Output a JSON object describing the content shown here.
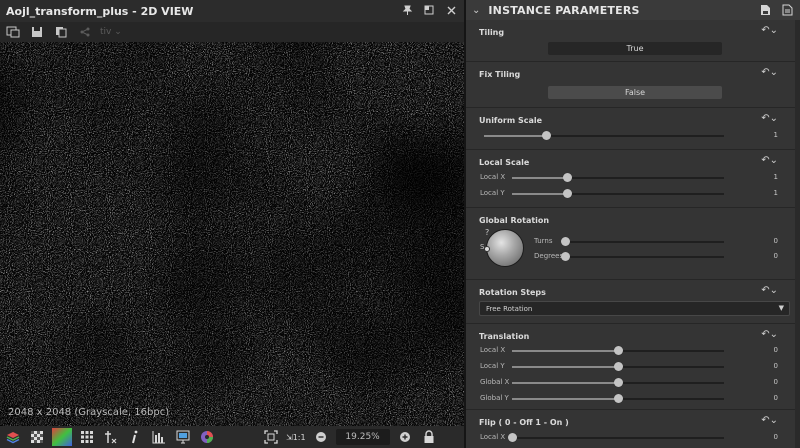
{
  "view": {
    "title": "Aojl_transform_plus - 2D VIEW",
    "toolbar_dropdown": "tiv",
    "image_info": "2048 x 2048 (Grayscale, 16bpc)",
    "zoom": "19.25%"
  },
  "params": {
    "header": "INSTANCE PARAMETERS",
    "tiling": {
      "label": "Tiling",
      "value": "True"
    },
    "fix_tiling": {
      "label": "Fix Tiling",
      "value": "False"
    },
    "uniform_scale": {
      "label": "Uniform Scale",
      "value": "1",
      "level": 0.26
    },
    "local_scale": {
      "label": "Local Scale",
      "x_label": "Local X",
      "x_value": "1",
      "x_level": 0.26,
      "y_label": "Local Y",
      "y_value": "1",
      "y_level": 0.26
    },
    "global_rotation": {
      "label": "Global Rotation",
      "dial_s": "S",
      "dial_mark": "?",
      "turns_label": "Turns",
      "turns_value": "0",
      "turns_level": 0.0,
      "degrees_label": "Degrees",
      "degrees_value": "0",
      "degrees_level": 0.0
    },
    "rotation_steps": {
      "label": "Rotation Steps",
      "value": "Free Rotation"
    },
    "translation": {
      "label": "Translation",
      "rows": [
        {
          "label": "Local X",
          "value": "0",
          "level": 0.5
        },
        {
          "label": "Local Y",
          "value": "0",
          "level": 0.5
        },
        {
          "label": "Global X",
          "value": "0",
          "level": 0.5
        },
        {
          "label": "Global Y",
          "value": "0",
          "level": 0.5
        }
      ]
    },
    "flip": {
      "label": "Flip  ( 0 - Off    1 - On )",
      "x_label": "Local X",
      "x_value": "0",
      "x_level": 0.0
    }
  },
  "icons": {
    "view_title": [
      "pin-icon",
      "restore-icon",
      "close-icon"
    ],
    "view_toolbar": [
      "export-icon",
      "save-icon",
      "copy-icon",
      "share-icon"
    ],
    "view_bottom": [
      "layers-icon",
      "checker-icon",
      "rgb-channels-icon",
      "grid-icon",
      "transform-icon",
      "info-icon",
      "histogram-icon",
      "display-icon",
      "color-icon",
      "fit-view-icon",
      "zoom-ratio-icon",
      "zoom-out-icon",
      "zoom-in-icon",
      "lock-icon"
    ],
    "params_header": [
      "save-preset-icon",
      "preset-icon"
    ]
  },
  "colors": {
    "accent_track": "#8a8a8a",
    "panel": "#343434",
    "true_button": "#2a2a2a",
    "false_button": "#4b4b4b"
  }
}
